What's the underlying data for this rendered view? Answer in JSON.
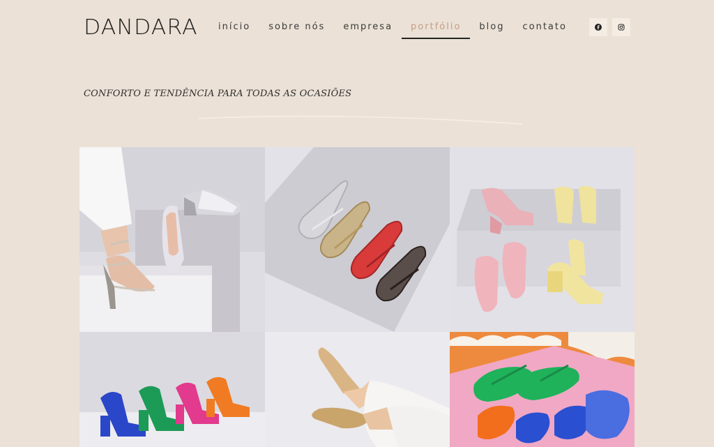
{
  "brand": {
    "name": "DANDARA"
  },
  "nav": {
    "items": [
      {
        "label": "início",
        "active": false
      },
      {
        "label": "sobre nós",
        "active": false
      },
      {
        "label": "empresa",
        "active": false
      },
      {
        "label": "portfólio",
        "active": true
      },
      {
        "label": "blog",
        "active": false
      },
      {
        "label": "contato",
        "active": false
      }
    ]
  },
  "social": [
    {
      "icon": "facebook-icon"
    },
    {
      "icon": "instagram-icon"
    }
  ],
  "tagline": "CONFORTO E TENDÊNCIA PARA TODAS AS OCASIÕES",
  "gallery": {
    "tiles": [
      {
        "subject": "metallic sandals and silver mary jane flats on white pedestals"
      },
      {
        "subject": "four mary jane flats in silver, gold, red and bronze"
      },
      {
        "subject": "pink and butter yellow heels and flats on pedestal"
      },
      {
        "subject": "colorful strappy block heel sandals in blue, green, pink and orange"
      },
      {
        "subject": "gold metallic pointed flats worn with white trousers"
      },
      {
        "subject": "colorful flip flop sandals on pink and orange background"
      }
    ]
  },
  "colors": {
    "background": "#ebe1d6",
    "accent": "#c59d83",
    "text": "#2e2e2e"
  }
}
